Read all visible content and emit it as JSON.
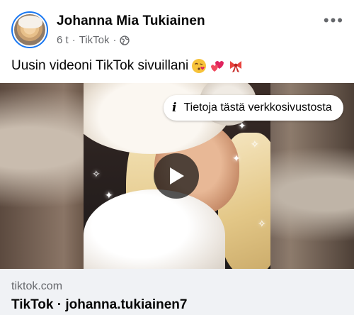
{
  "post": {
    "author": "Johanna Mia Tukiainen",
    "time": "6 t",
    "separator": "·",
    "source": "TikTok",
    "message": "Uusin videoni TikTok sivuillani",
    "emojis": [
      "kissing-heart-emoji",
      "hearts-emoji",
      "ribbon-emoji"
    ]
  },
  "media": {
    "info_label": "Tietoja tästä verkkosivustosta"
  },
  "link": {
    "domain": "tiktok.com",
    "title": "TikTok · johanna.tukiainen7"
  },
  "colors": {
    "avatar_ring": "#1877f2",
    "secondary_text": "#65676b",
    "link_background": "#f0f2f5"
  }
}
